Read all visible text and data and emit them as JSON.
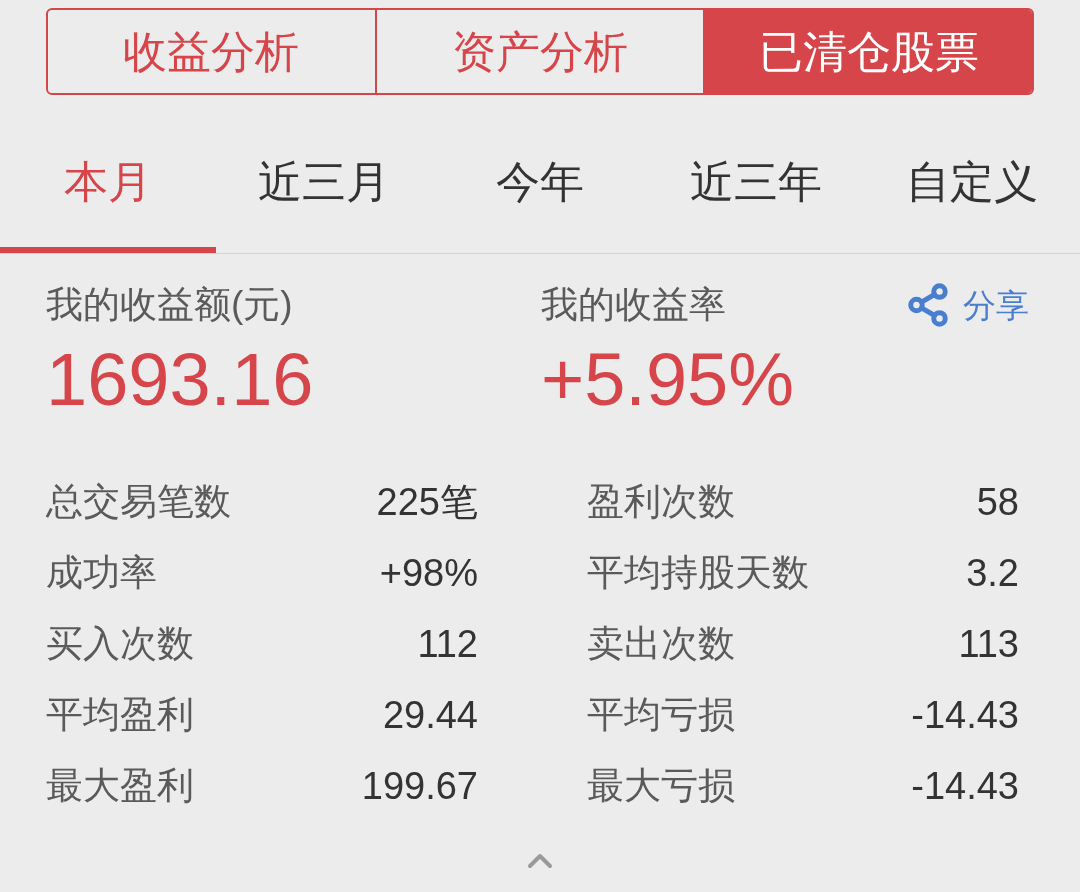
{
  "segments": [
    {
      "label": "收益分析",
      "selected": false
    },
    {
      "label": "资产分析",
      "selected": false
    },
    {
      "label": "已清仓股票",
      "selected": true
    }
  ],
  "periods": [
    {
      "label": "本月",
      "selected": true
    },
    {
      "label": "近三月",
      "selected": false
    },
    {
      "label": "今年",
      "selected": false
    },
    {
      "label": "近三年",
      "selected": false
    },
    {
      "label": "自定义",
      "selected": false
    }
  ],
  "summary": {
    "amount": {
      "label": "我的收益额(元)",
      "value": "1693.16"
    },
    "rate": {
      "label": "我的收益率",
      "value": "+5.95%"
    },
    "share": "分享"
  },
  "stats": [
    {
      "cells": [
        {
          "label": "总交易笔数",
          "value": "225笔"
        },
        {
          "label": "盈利次数",
          "value": "58"
        }
      ]
    },
    {
      "cells": [
        {
          "label": "成功率",
          "value": "+98%"
        },
        {
          "label": "平均持股天数",
          "value": "3.2"
        }
      ]
    },
    {
      "cells": [
        {
          "label": "买入次数",
          "value": "112"
        },
        {
          "label": "卖出次数",
          "value": "113"
        }
      ]
    },
    {
      "cells": [
        {
          "label": "平均盈利",
          "value": "29.44"
        },
        {
          "label": "平均亏损",
          "value": "-14.43"
        }
      ]
    },
    {
      "cells": [
        {
          "label": "最大盈利",
          "value": "199.67"
        },
        {
          "label": "最大亏损",
          "value": "-14.43"
        }
      ]
    }
  ]
}
